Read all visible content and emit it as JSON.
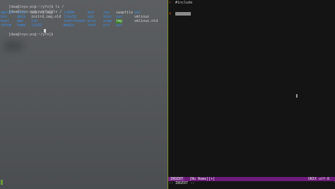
{
  "terminal": {
    "lines": [
      {
        "prompt": "[dwa@lnyu-pc@:~/yfo]$",
        "cmd": " ls /"
      },
      {
        "prompt": "[dwa@lnyu-pc@:~/yfo]$",
        "cmd": "ls /"
      }
    ],
    "ls_rows": [
      [
        "apollo",
        "core",
        "initrd.img",
        "lib64",
        "mnt",
        "run",
        "swapfile",
        "var"
      ],
      [
        "bin",
        "data",
        "initrd.img.old",
        "libx32",
        "opt",
        "sbin",
        "sys",
        "vmlinuz"
      ],
      [
        "boot",
        "dev",
        "lib",
        "lost+found",
        "proc",
        "snap",
        "tmp",
        "vmlinuz.old"
      ],
      [
        "cdrom",
        "home",
        "lib32",
        "media",
        "root",
        "srv",
        "usr",
        ""
      ]
    ],
    "final_prompt": "[dwa@lnyu-pc@:~/yfo]$"
  },
  "vim": {
    "gutter": [
      ">",
      "4"
    ],
    "text_line1": "#include",
    "statusline_mode": "INSERT",
    "statusline_file": "[No Name][+]",
    "statusline_right": "UNIX  utf-8",
    "cmdline": "-- INSERT --"
  },
  "colors": {
    "terminal_bg": "#55585b",
    "vim_bg": "#141414",
    "statusline": "#6c1b79",
    "divider": "#7a8f2e",
    "dir_color": "#3a8fe6"
  }
}
